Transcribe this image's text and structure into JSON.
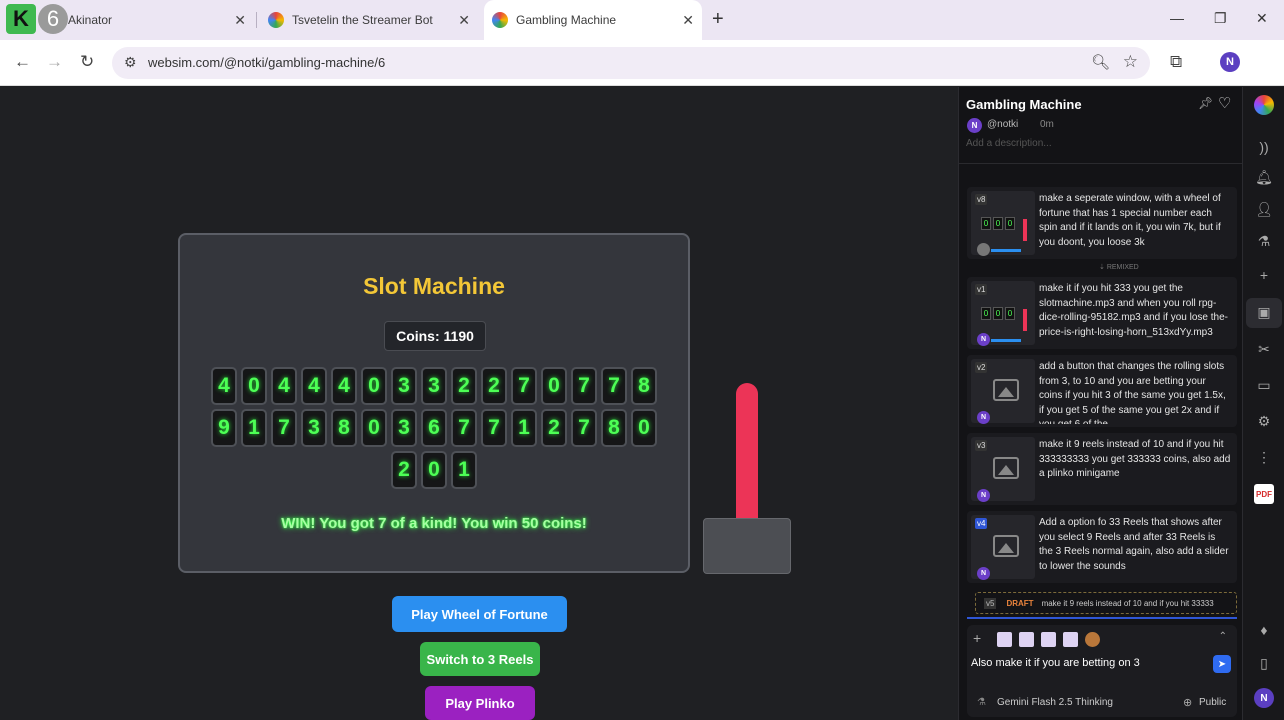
{
  "browser": {
    "tabs": [
      {
        "title": "Akinator",
        "active": false
      },
      {
        "title": "Tsvetelin the Streamer Bot",
        "active": false
      },
      {
        "title": "Gambling Machine",
        "active": true
      }
    ],
    "url": "websim.com/@notki/gambling-machine/6",
    "profile_initial": "N",
    "k_logo": "K",
    "six_logo": "6"
  },
  "game": {
    "title": "Slot Machine",
    "coins_label": "Coins: 1190",
    "reels": [
      [
        "4",
        "0",
        "4",
        "4",
        "4",
        "0",
        "3",
        "3",
        "2",
        "2",
        "7",
        "0",
        "7",
        "7",
        "8"
      ],
      [
        "9",
        "1",
        "7",
        "3",
        "8",
        "0",
        "3",
        "6",
        "7",
        "7",
        "1",
        "2",
        "7",
        "8",
        "0"
      ],
      [
        "2",
        "0",
        "1"
      ]
    ],
    "result": "WIN! You got 7 of a kind! You win 50 coins!",
    "lever_color": "#ec3457",
    "buttons": {
      "wheel": "Play Wheel of Fortune",
      "reels": "Switch to 3 Reels",
      "plinko": "Play Plinko"
    }
  },
  "panel": {
    "title": "Gambling Machine",
    "user": "@notki",
    "time": "0m",
    "description_placeholder": "Add a description...",
    "remixed_label": "REMIXED",
    "versions": [
      {
        "tag": "v8",
        "text": "make a seperate window, with a wheel of fortune that has 1 special number each spin and if it lands on it, you win 7k, but if you doont, you loose 3k",
        "thumb": "slot"
      },
      {
        "tag": "v1",
        "text": "make it if you hit 333 you get the slotmachine.mp3 and when you roll rpg-dice-rolling-95182.mp3 and if you lose the-price-is-right-losing-horn_513xdYy.mp3",
        "thumb": "slot"
      },
      {
        "tag": "v2",
        "text": "add a button that changes the rolling slots from 3, to 10 and you are betting your coins if you hit 3 of the same you get 1.5x, if you get 5 of the same you get 2x and if you get 6 of the",
        "thumb": "image"
      },
      {
        "tag": "v3",
        "text": "make it 9 reels instead of 10 and if you hit 333333333 you get 333333 coins, also add a plinko minigame",
        "thumb": "image"
      },
      {
        "tag": "v4",
        "text": "Add a option fo 33 Reels that shows after you select 9 Reels and after 33 Reels is the 3 Reels normal again, also add a slider to lower the sounds",
        "thumb": "image"
      }
    ],
    "draft": {
      "tag": "v5",
      "label": "DRAFT",
      "text": "make it 9 reels instead of 10 and if you hit 33333"
    },
    "composer": {
      "text": "Also make it if you are betting on 3",
      "model": "Gemini Flash 2.5 Thinking",
      "visibility": "Public"
    }
  },
  "rail": {
    "avatar": "N",
    "app_badge": "PDF"
  }
}
